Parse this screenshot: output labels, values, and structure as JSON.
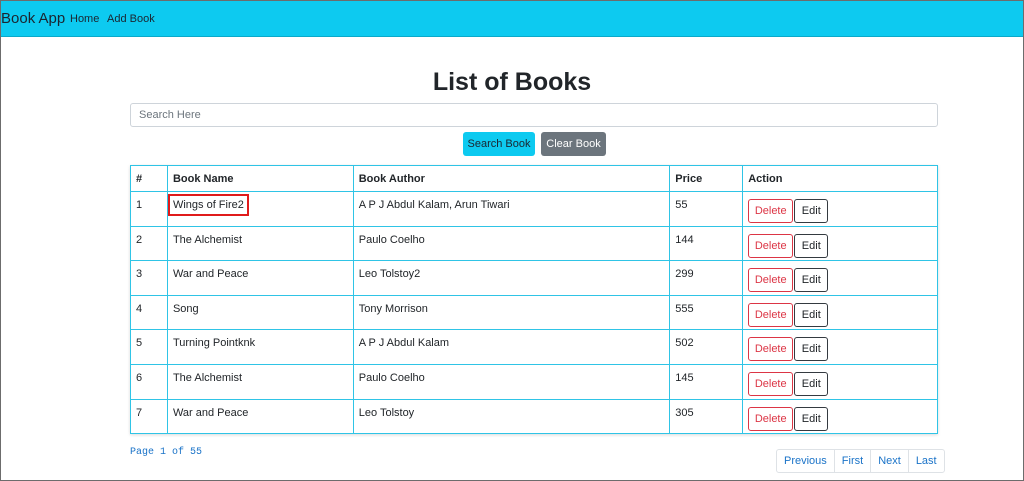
{
  "navbar": {
    "brand": "Book App",
    "links": [
      "Home",
      "Add Book"
    ],
    "color": "#0dcaf0"
  },
  "main": {
    "title": "List of Books",
    "search_placeholder": "Search Here",
    "search_button": "Search Book",
    "clear_button": "Clear Book"
  },
  "table": {
    "headers": [
      "#",
      "Book Name",
      "Book Author",
      "Price",
      "Action"
    ],
    "rows": [
      {
        "num": "1",
        "name": "Wings of Fire2",
        "author": "A P J Abdul Kalam, Arun Tiwari",
        "price": "55"
      },
      {
        "num": "2",
        "name": "The Alchemist",
        "author": "Paulo Coelho",
        "price": "144"
      },
      {
        "num": "3",
        "name": "War and Peace",
        "author": "Leo Tolstoy2",
        "price": "299"
      },
      {
        "num": "4",
        "name": "Song",
        "author": "Tony Morrison",
        "price": "555"
      },
      {
        "num": "5",
        "name": "Turning Pointknk",
        "author": "A P J Abdul Kalam",
        "price": "502"
      },
      {
        "num": "6",
        "name": "The Alchemist",
        "author": "Paulo Coelho",
        "price": "145"
      },
      {
        "num": "7",
        "name": "War and Peace",
        "author": "Leo Tolstoy",
        "price": "305"
      }
    ],
    "delete_label": "Delete",
    "edit_label": "Edit",
    "highlighted_row": 0
  },
  "footer": {
    "page_info": "Page 1 of 55",
    "pagination": [
      "Previous",
      "First",
      "Next",
      "Last"
    ]
  }
}
